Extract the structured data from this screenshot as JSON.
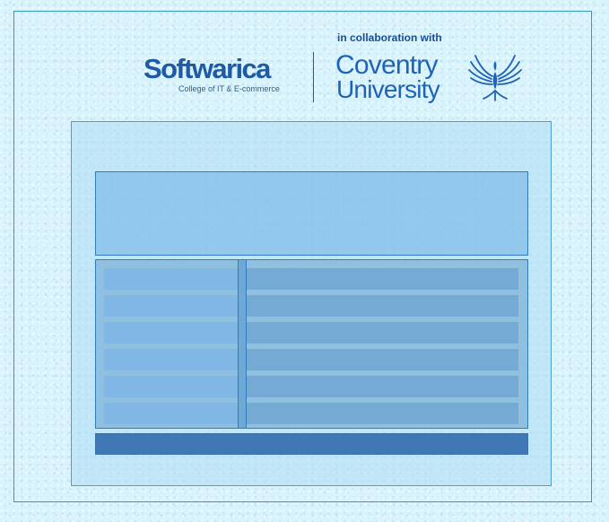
{
  "header": {
    "softwarica": {
      "name": "Softwarica",
      "subtitle": "College of IT & E-commerce",
      "brand_color": "#1f5aa7"
    },
    "collaboration_label": "in collaboration with",
    "coventry": {
      "line1": "Coventry",
      "line2": "University",
      "brand_color": "#1f63b6",
      "emblem_icon": "phoenix-icon"
    }
  },
  "colors": {
    "page_background": "#d8f3fb",
    "frame_border": "#3c96b7",
    "panel_fill": "#aedbf6",
    "banner_fill": "#7fbae8",
    "table_fill": "#8fc0e0",
    "row_left_fill": "#7fb5e4",
    "row_right_fill": "#74a9d3",
    "footer_fill": "#3f78b5"
  },
  "table": {
    "rows": [
      {
        "left": "",
        "right": ""
      },
      {
        "left": "",
        "right": ""
      },
      {
        "left": "",
        "right": ""
      },
      {
        "left": "",
        "right": ""
      },
      {
        "left": "",
        "right": ""
      },
      {
        "left": "",
        "right": ""
      }
    ]
  },
  "footer": {
    "label": ""
  }
}
